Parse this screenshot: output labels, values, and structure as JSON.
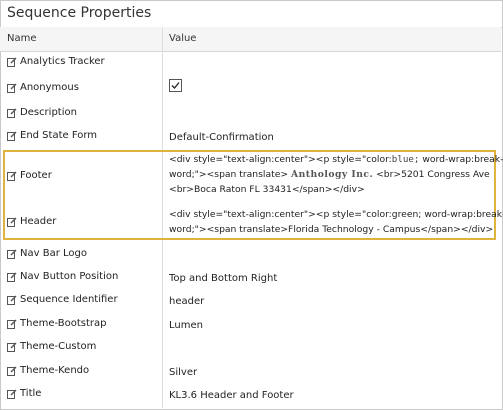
{
  "panel": {
    "title": "Sequence Properties",
    "columns": {
      "name": "Name",
      "value": "Value"
    }
  },
  "rows": [
    {
      "name": "Analytics Tracker",
      "value": ""
    },
    {
      "name": "Anonymous",
      "value": "",
      "checked": true
    },
    {
      "name": "Description",
      "value": ""
    },
    {
      "name": "End State Form",
      "value": "Default-Confirmation"
    },
    {
      "name": "Footer",
      "value_lines": [
        {
          "a": "<div style=\"text-align:center\"><p style=\"color:",
          "mono": "blue;",
          "b": " word-wrap:break-"
        },
        {
          "a": "word;\"><span translate> ",
          "serif": "Anthology Inc.",
          "b": " <br>5201 Congress Ave"
        },
        {
          "a": "<br>Boca Raton FL 33431</span></div>"
        }
      ]
    },
    {
      "name": "Header",
      "value_lines": [
        {
          "a": "<div style=\"text-align:center\"><p style=\"color:green; word-wrap:break-"
        },
        {
          "a": "word;\"><span translate>Florida Technology - Campus</span></div>"
        }
      ]
    },
    {
      "name": "Nav Bar Logo",
      "value": ""
    },
    {
      "name": "Nav Button Position",
      "value": "Top and Bottom Right"
    },
    {
      "name": "Sequence Identifier",
      "value": "header"
    },
    {
      "name": "Theme-Bootstrap",
      "value": "Lumen"
    },
    {
      "name": "Theme-Custom",
      "value": ""
    },
    {
      "name": "Theme-Kendo",
      "value": "Silver"
    },
    {
      "name": "Title",
      "value": "KL3.6 Header and Footer"
    }
  ],
  "icons": {
    "edit": "edit-icon",
    "checkbox": "checkbox-checked-icon"
  },
  "colors": {
    "highlight": "#e0b43c",
    "divider": "#dcdcdc",
    "header_bg": "#f5f5f5"
  }
}
